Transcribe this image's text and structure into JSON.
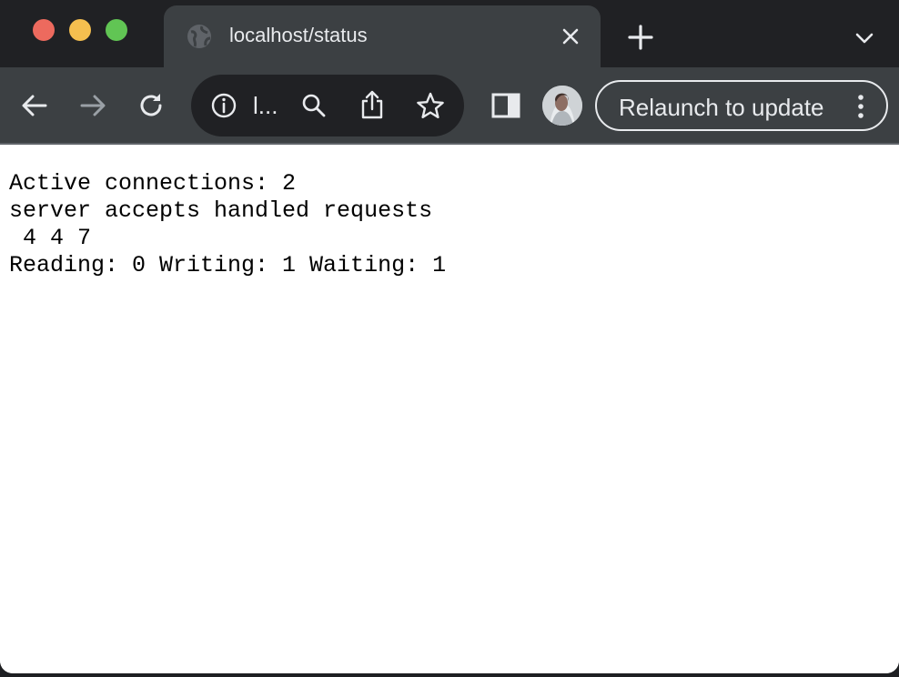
{
  "window": {
    "traffic_lights": {
      "close_color": "#ed6a5e",
      "minimize_color": "#f5bf4f",
      "maximize_color": "#61c554"
    }
  },
  "tab": {
    "title": "localhost/status",
    "favicon": "globe-icon",
    "close_icon": "close-icon"
  },
  "tabstrip": {
    "new_tab_icon": "plus-icon",
    "tab_search_icon": "chevron-down-icon"
  },
  "toolbar": {
    "back_icon": "arrow-left-icon",
    "forward_icon": "arrow-right-icon",
    "reload_icon": "reload-icon",
    "omnibox": {
      "site_info_icon": "info-icon",
      "url_text": "l...",
      "search_icon": "search-icon",
      "share_icon": "share-icon",
      "bookmark_icon": "star-icon"
    },
    "side_panel_icon": "side-panel-icon",
    "profile_icon": "avatar",
    "relaunch_label": "Relaunch to update",
    "menu_icon": "kebab-menu-icon"
  },
  "page": {
    "lines": [
      "Active connections: 2",
      "server accepts handled requests",
      " 4 4 7",
      "Reading: 0 Writing: 1 Waiting: 1"
    ]
  },
  "colors": {
    "tabstrip_bg": "#202124",
    "toolbar_bg": "#3c4043",
    "omnibox_bg": "#202124",
    "ui_text": "#e8eaed",
    "page_bg": "#ffffff",
    "page_text": "#000000"
  }
}
